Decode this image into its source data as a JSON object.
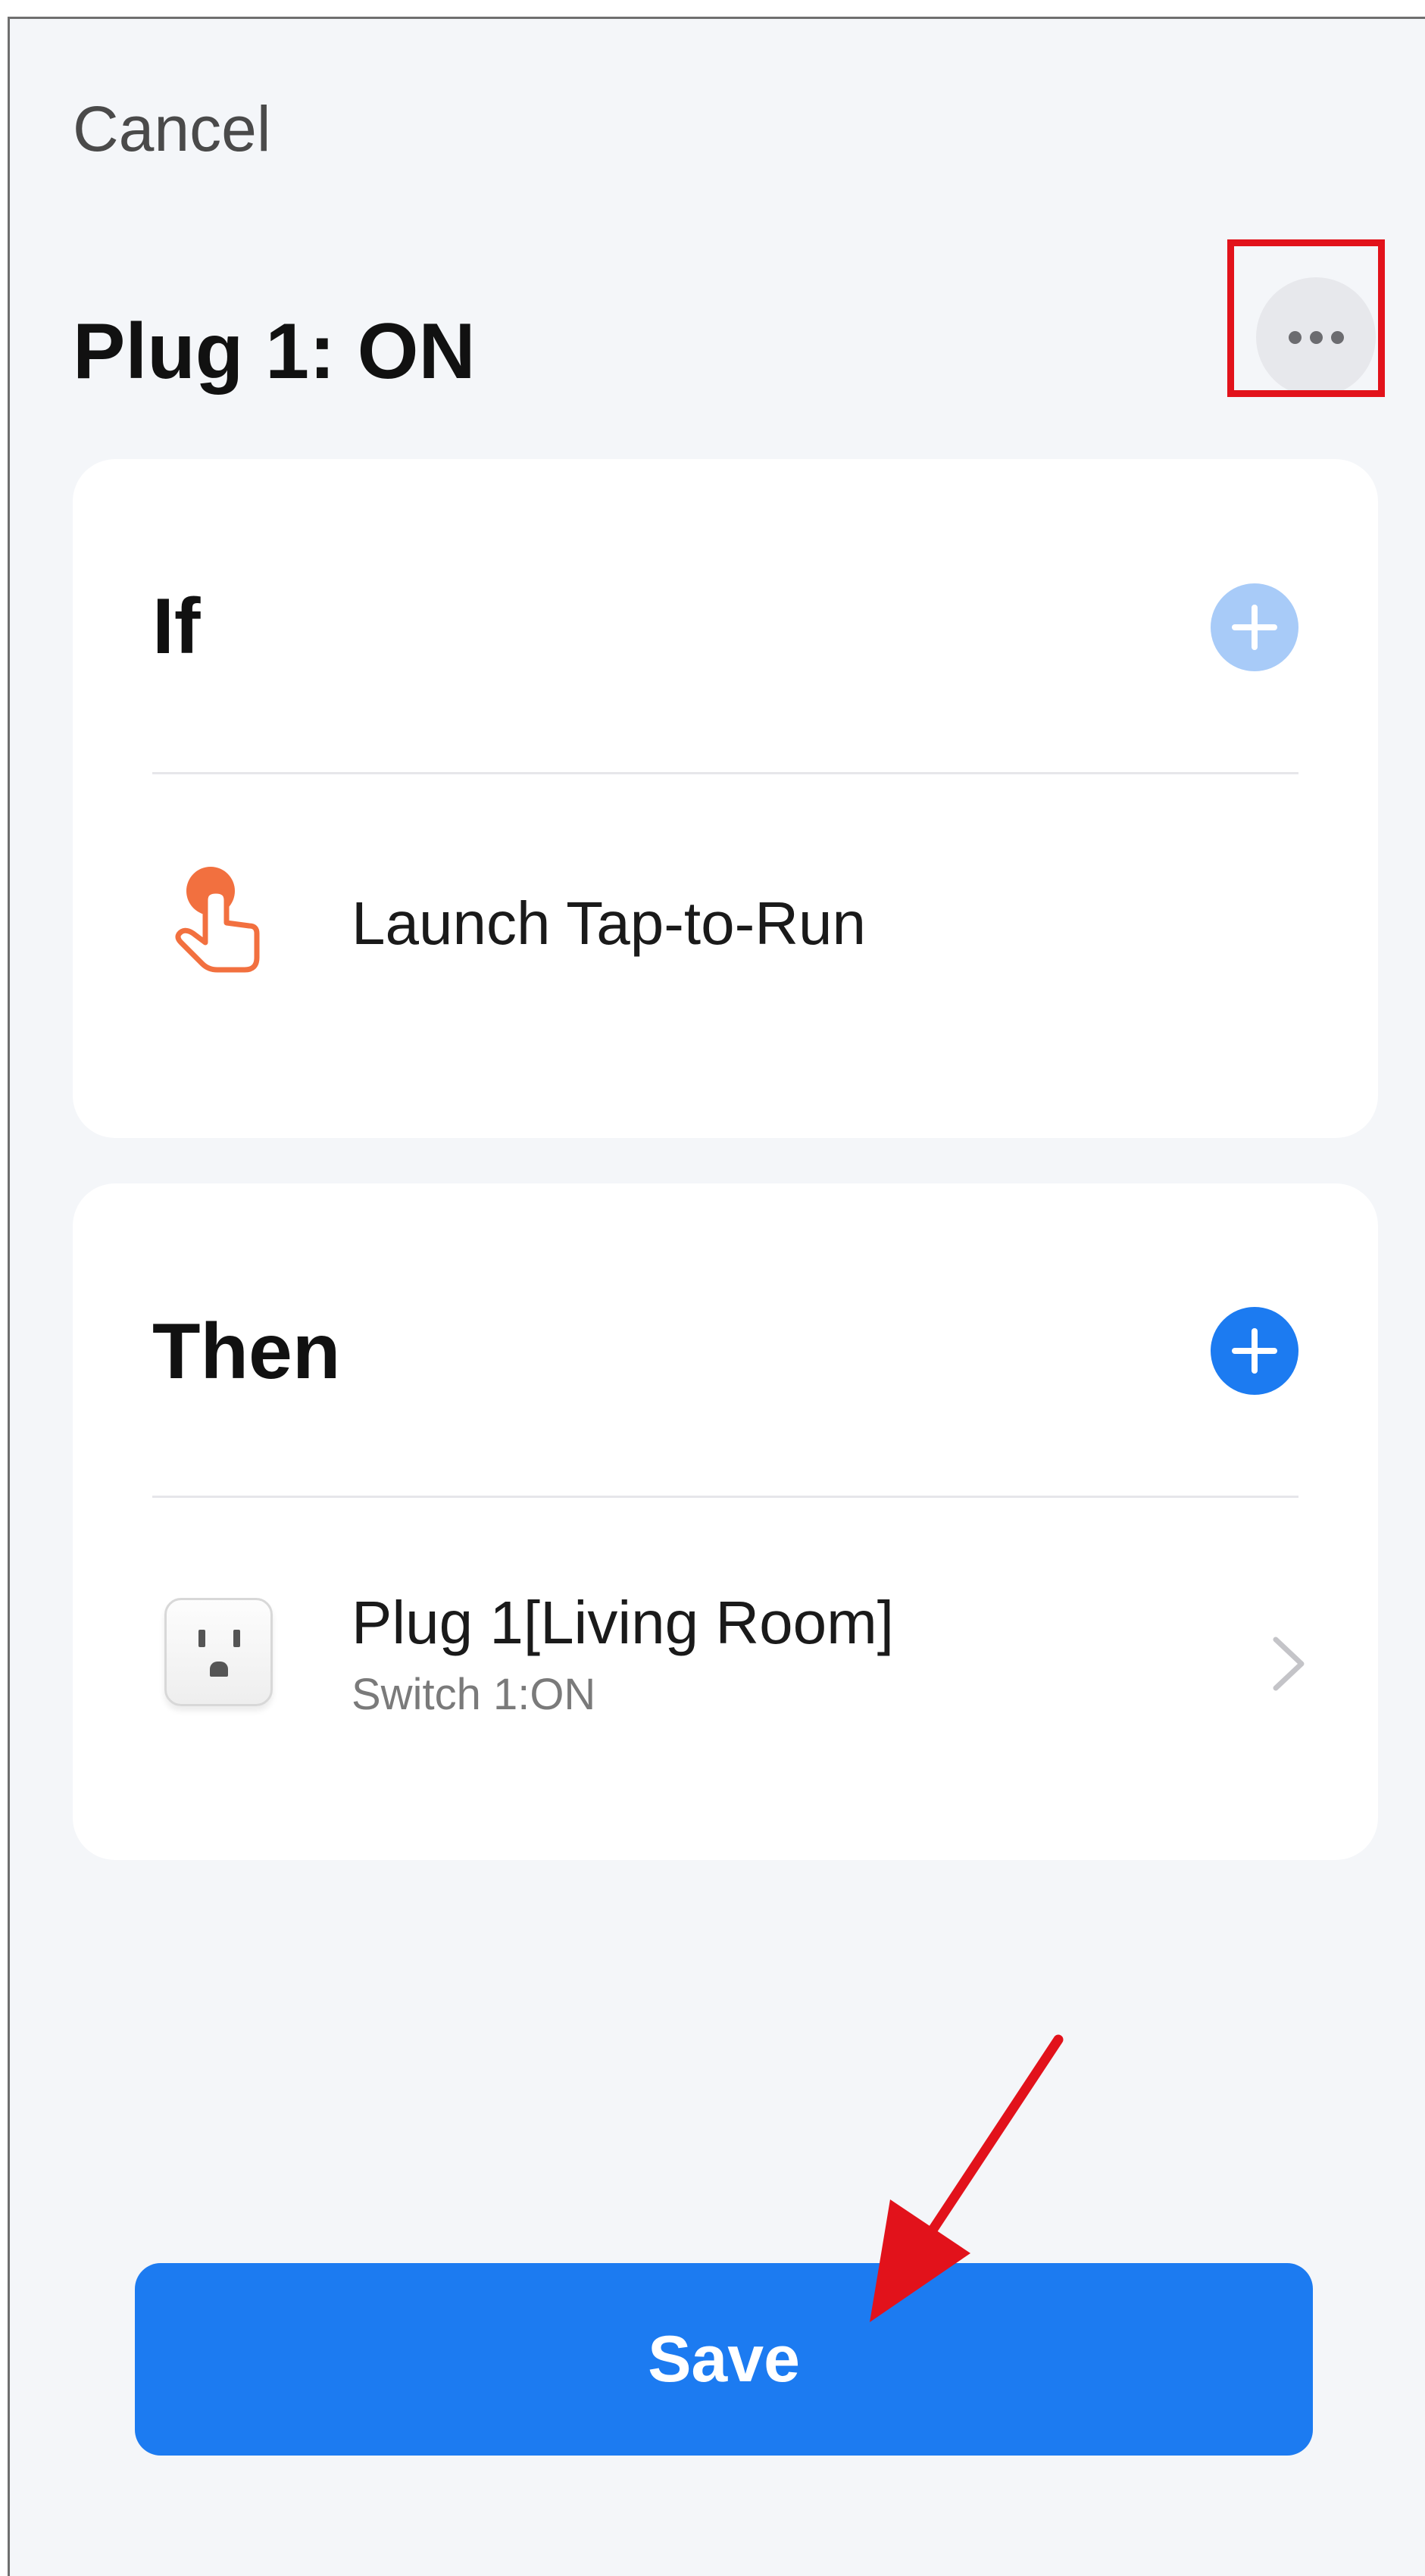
{
  "header": {
    "cancel_label": "Cancel",
    "title": "Plug 1: ON",
    "more_icon": "ellipsis-icon"
  },
  "if_section": {
    "heading": "If",
    "add_icon": "plus-circle-icon",
    "add_color": "#a8cbf8",
    "condition": {
      "icon": "tap-finger-icon",
      "icon_color": "#f2703f",
      "label": "Launch Tap-to-Run"
    }
  },
  "then_section": {
    "heading": "Then",
    "add_icon": "plus-circle-icon",
    "add_color": "#1c7bf1",
    "action": {
      "icon": "smart-plug-icon",
      "label": "Plug 1[Living Room]",
      "sublabel": "Switch 1:ON",
      "chevron_icon": "chevron-right-icon"
    }
  },
  "footer": {
    "save_label": "Save",
    "save_color": "#1c7bf1"
  },
  "annotations": {
    "highlight_color": "#e2121b",
    "arrow_color": "#e2121b"
  }
}
